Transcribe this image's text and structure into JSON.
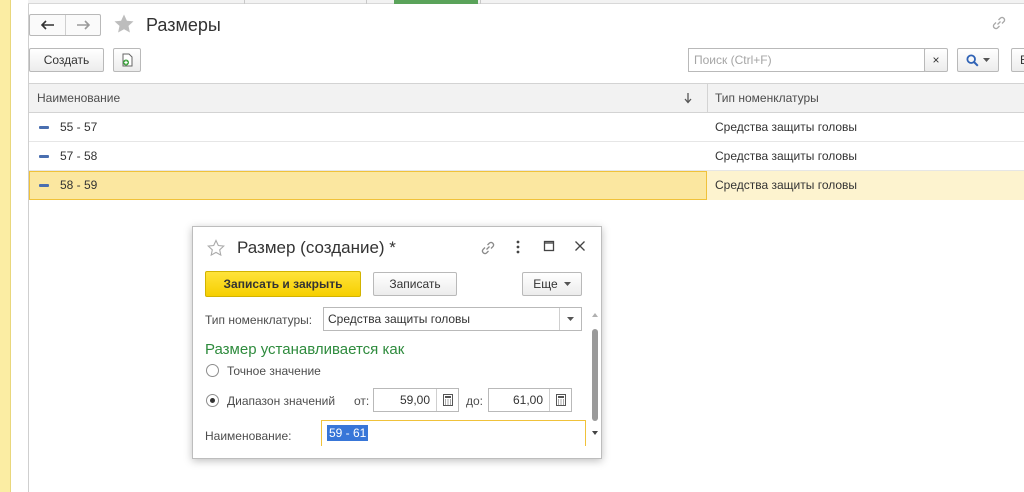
{
  "page": {
    "title": "Размеры",
    "create_label": "Создать",
    "search_placeholder": "Поиск (Ctrl+F)",
    "clear_label": "×",
    "extra_label": "Е"
  },
  "icons": {
    "back": "arrow-left-icon",
    "forward": "arrow-right-icon",
    "favorite": "star-icon",
    "link": "link-icon",
    "copy": "copy-document-icon",
    "search": "search-icon",
    "sort": "sort-down-icon",
    "row": "item-icon",
    "more": "more-vertical-icon",
    "maximize": "maximize-icon",
    "close": "close-icon",
    "calculator": "calculator-icon"
  },
  "table": {
    "columns": [
      "Наименование",
      "Тип номенклатуры"
    ],
    "rows": [
      {
        "name": "55 - 57",
        "type": "Средства защиты головы",
        "selected": false
      },
      {
        "name": "57 - 58",
        "type": "Средства защиты головы",
        "selected": false
      },
      {
        "name": "58 - 59",
        "type": "Средства защиты головы",
        "selected": true
      }
    ]
  },
  "dialog": {
    "title": "Размер (создание) *",
    "save_close_label": "Записать и закрыть",
    "save_label": "Записать",
    "more_label": "Еще",
    "type_label": "Тип номенклатуры:",
    "type_value": "Средства защиты головы",
    "group_title": "Размер устанавливается как",
    "radio_exact": "Точное значение",
    "radio_range": "Диапазон значений",
    "range_selected": true,
    "from_label": "от:",
    "from_value": "59,00",
    "to_label": "до:",
    "to_value": "61,00",
    "name_label": "Наименование:",
    "name_value": "59 - 61"
  },
  "colors": {
    "accent_yellow": "#f6cf00",
    "selection": "#fbe7a0",
    "group_title_green": "#2e8b3d",
    "row_icon_blue": "#4a6fb0",
    "text_selection": "#3876d8"
  }
}
